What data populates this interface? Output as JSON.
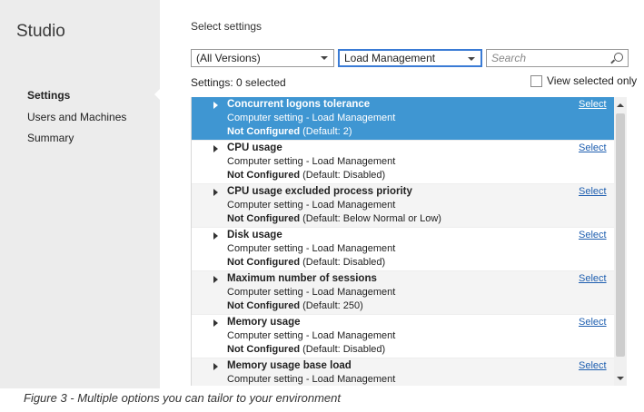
{
  "app": {
    "title": "Studio"
  },
  "sidebar": {
    "items": [
      {
        "label": "Settings",
        "active": true
      },
      {
        "label": "Users and Machines",
        "active": false
      },
      {
        "label": "Summary",
        "active": false
      }
    ]
  },
  "main": {
    "heading": "Select settings",
    "version_dropdown": {
      "value": "(All Versions)"
    },
    "category_dropdown": {
      "value": "Load Management"
    },
    "search": {
      "placeholder": "Search"
    },
    "selected_count": "Settings: 0 selected",
    "view_selected_only": {
      "label": "View selected only",
      "checked": false
    },
    "select_label": "Select",
    "settings": [
      {
        "name": "Concurrent logons tolerance",
        "desc": "Computer setting - Load Management",
        "status": "Not Configured",
        "default": "(Default: 2)",
        "selected": true
      },
      {
        "name": "CPU usage",
        "desc": "Computer setting - Load Management",
        "status": "Not Configured",
        "default": "(Default: Disabled)"
      },
      {
        "name": "CPU usage excluded process priority",
        "desc": "Computer setting - Load Management",
        "status": "Not Configured",
        "default": "(Default: Below Normal or Low)"
      },
      {
        "name": "Disk usage",
        "desc": "Computer setting - Load Management",
        "status": "Not Configured",
        "default": "(Default: Disabled)"
      },
      {
        "name": "Maximum number of sessions",
        "desc": "Computer setting - Load Management",
        "status": "Not Configured",
        "default": "(Default: 250)"
      },
      {
        "name": "Memory usage",
        "desc": "Computer setting - Load Management",
        "status": "Not Configured",
        "default": "(Default: Disabled)"
      },
      {
        "name": "Memory usage base load",
        "desc": "Computer setting - Load Management",
        "status": "",
        "default": ""
      }
    ]
  },
  "caption": "Figure 3 - Multiple options you can tailor to your environment",
  "colors": {
    "selection": "#3f96d2",
    "link": "#1f5fb0",
    "sidebar": "#ececec"
  }
}
